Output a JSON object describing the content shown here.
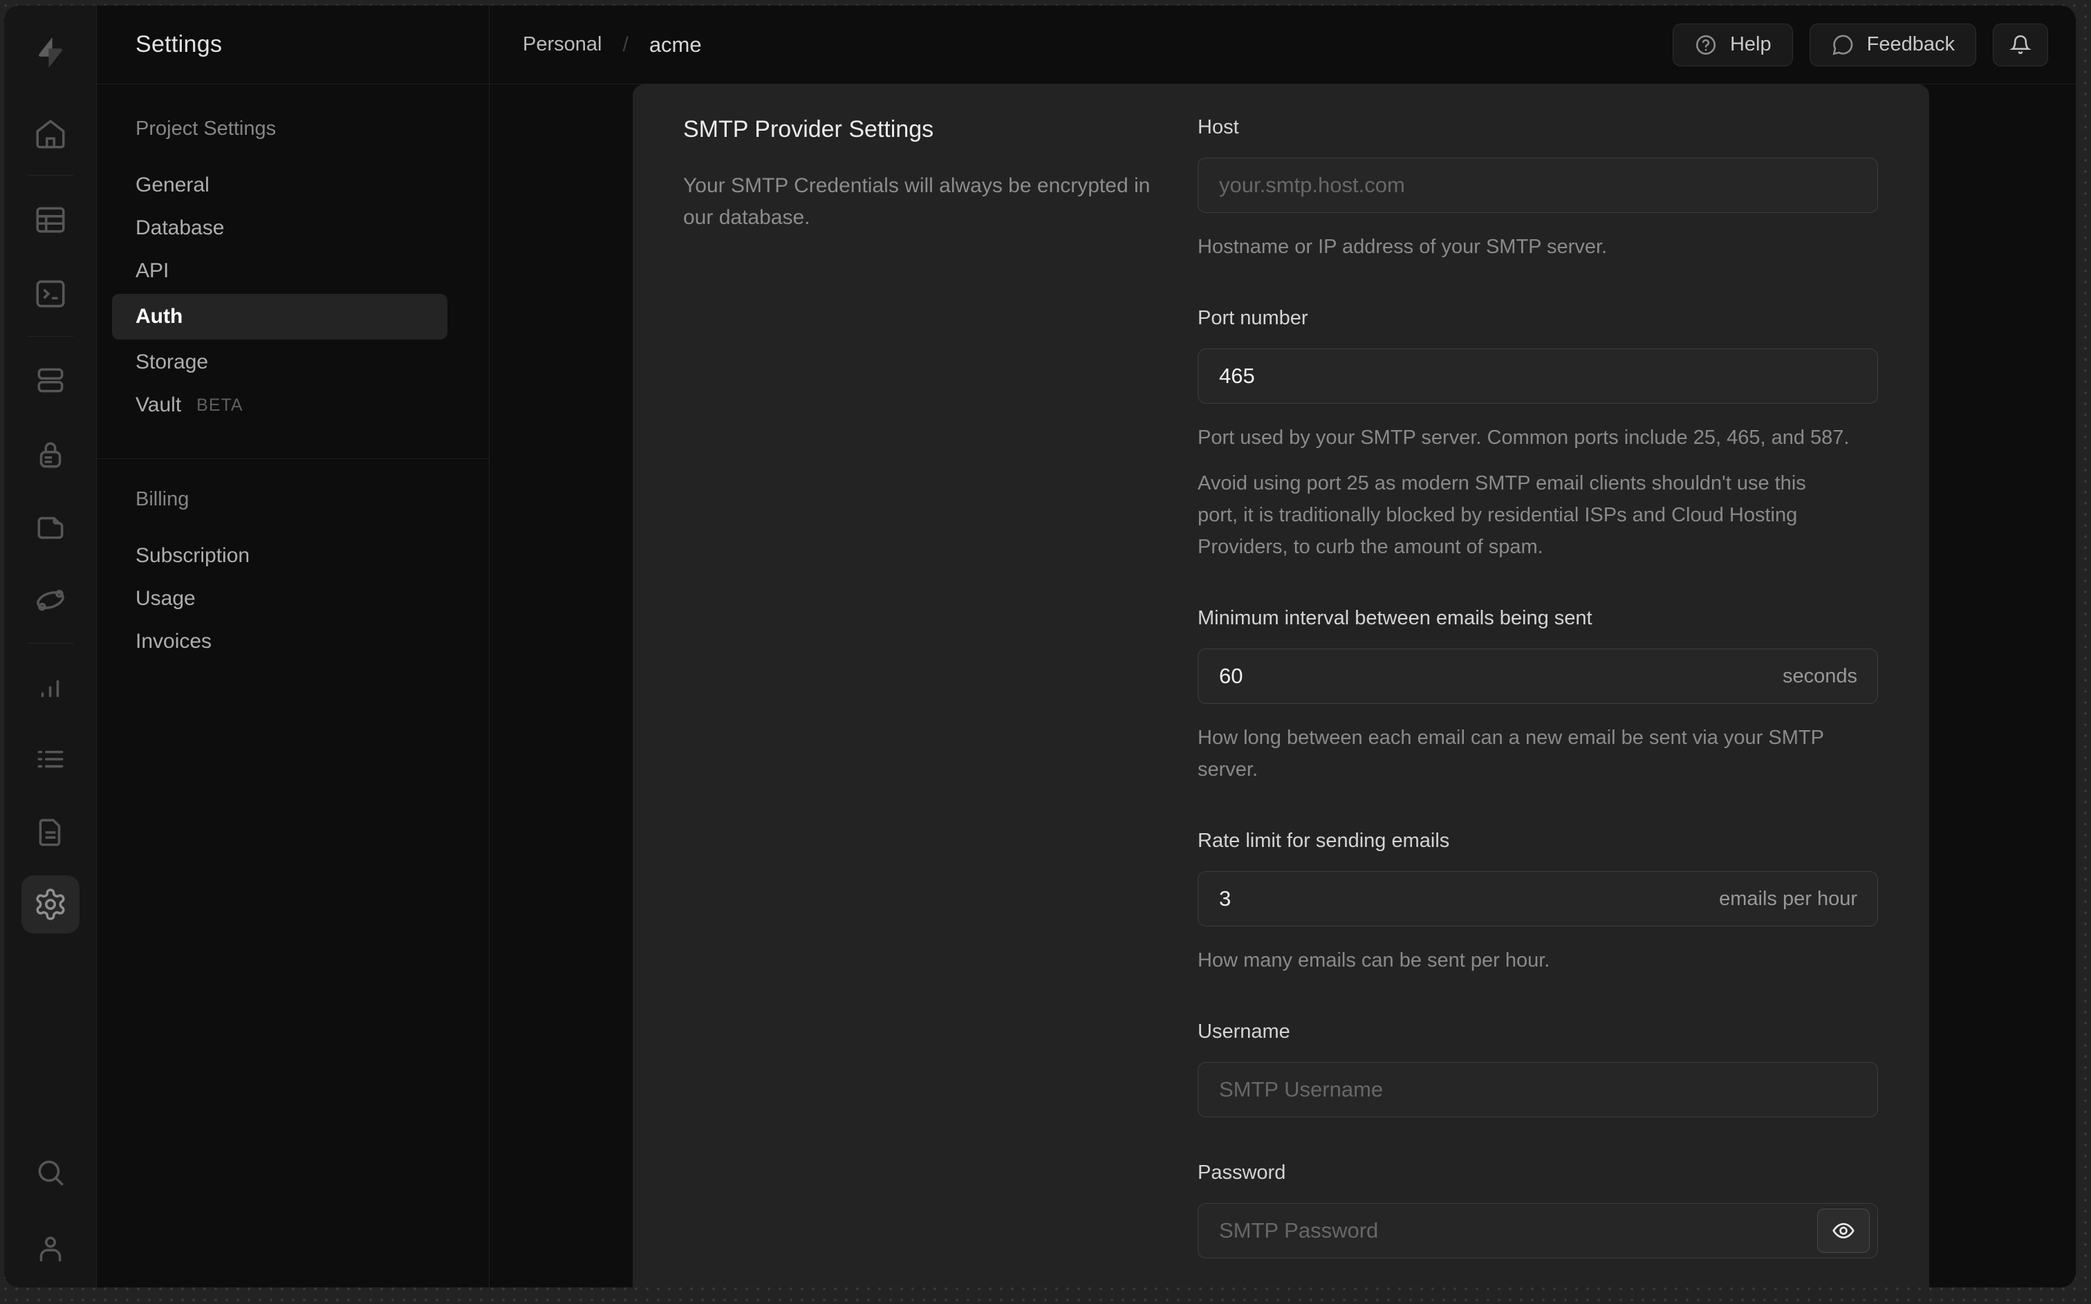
{
  "colors": {
    "window_bg": "#0d0d0d",
    "rail_bg": "#161616",
    "panel_bg": "#232323",
    "input_border": "#3d3d3d",
    "text_primary": "#ececec",
    "text_muted": "#8a8a8a"
  },
  "icons": [
    "supabase-logo",
    "home",
    "table-editor",
    "sql-editor",
    "database",
    "auth-lock",
    "storage",
    "edge-functions",
    "reports",
    "logs",
    "docs",
    "settings-gear",
    "search",
    "user",
    "help-circle",
    "feedback-bubble",
    "bell",
    "eye"
  ],
  "nav": {
    "title": "Settings",
    "sections": [
      {
        "heading": "Project Settings",
        "items": [
          {
            "label": "General"
          },
          {
            "label": "Database"
          },
          {
            "label": "API"
          },
          {
            "label": "Auth"
          },
          {
            "label": "Storage"
          },
          {
            "label": "Vault",
            "badge": "BETA"
          }
        ]
      },
      {
        "heading": "Billing",
        "items": [
          {
            "label": "Subscription"
          },
          {
            "label": "Usage"
          },
          {
            "label": "Invoices"
          }
        ]
      }
    ]
  },
  "header": {
    "breadcrumb": {
      "org": "Personal",
      "separator": "/",
      "project": "acme"
    },
    "help_label": "Help",
    "feedback_label": "Feedback"
  },
  "form": {
    "section_title": "SMTP Provider Settings",
    "section_description": "Your SMTP Credentials will always be encrypted in our database.",
    "fields": [
      {
        "label": "Host",
        "placeholder": "your.smtp.host.com",
        "helper": "Hostname or IP address of your SMTP server."
      },
      {
        "label": "Port number",
        "value": "465",
        "helper": "Port used by your SMTP server. Common ports include 25, 465, and 587.",
        "note": "Avoid using port 25 as modern SMTP email clients shouldn't use this port, it is traditionally blocked by residential ISPs and Cloud Hosting Providers, to curb the amount of spam."
      },
      {
        "label": "Minimum interval between emails being sent",
        "value": "60",
        "suffix": "seconds",
        "helper": "How long between each email can a new email be sent via your SMTP server."
      },
      {
        "label": "Rate limit for sending emails",
        "value": "3",
        "suffix": "emails per hour",
        "helper": "How many emails can be sent per hour."
      },
      {
        "label": "Username",
        "placeholder": "SMTP Username"
      },
      {
        "label": "Password",
        "placeholder": "SMTP Password"
      }
    ]
  }
}
